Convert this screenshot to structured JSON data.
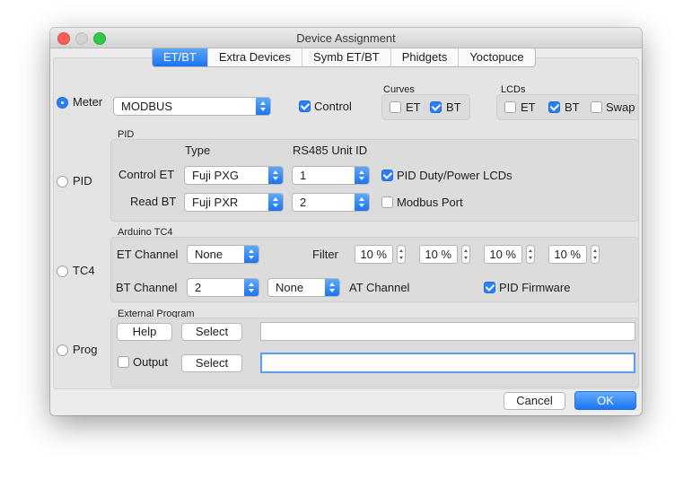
{
  "window": {
    "title": "Device Assignment"
  },
  "tabs": [
    {
      "label": "ET/BT",
      "active": true
    },
    {
      "label": "Extra Devices"
    },
    {
      "label": "Symb ET/BT"
    },
    {
      "label": "Phidgets"
    },
    {
      "label": "Yoctopuce"
    }
  ],
  "modes": [
    {
      "label": "Meter",
      "selected": true
    },
    {
      "label": "PID",
      "selected": false
    },
    {
      "label": "TC4",
      "selected": false
    },
    {
      "label": "Prog",
      "selected": false
    }
  ],
  "meter": {
    "device": "MODBUS",
    "control_label": "Control",
    "control_checked": true
  },
  "curves": {
    "title": "Curves",
    "et_label": "ET",
    "et_checked": false,
    "bt_label": "BT",
    "bt_checked": true
  },
  "lcds": {
    "title": "LCDs",
    "et_label": "ET",
    "et_checked": false,
    "bt_label": "BT",
    "bt_checked": true,
    "swap_label": "Swap",
    "swap_checked": false
  },
  "pid": {
    "title": "PID",
    "type_header": "Type",
    "unit_header": "RS485 Unit ID",
    "control_et_label": "Control ET",
    "control_et_type": "Fuji PXG",
    "control_et_unit": "1",
    "read_bt_label": "Read BT",
    "read_bt_type": "Fuji PXR",
    "read_bt_unit": "2",
    "duty_label": "PID Duty/Power LCDs",
    "duty_checked": true,
    "modbus_label": "Modbus Port",
    "modbus_checked": false
  },
  "arduino": {
    "title": "Arduino TC4",
    "et_channel_label": "ET Channel",
    "et_channel": "None",
    "filter_label": "Filter",
    "filters": [
      "10 %",
      "10 %",
      "10 %",
      "10 %"
    ],
    "bt_channel_label": "BT Channel",
    "bt_channel": "2",
    "at_channel": "None",
    "at_channel_label": "AT Channel",
    "pid_firmware_label": "PID Firmware",
    "pid_firmware_checked": true
  },
  "external": {
    "title": "External Program",
    "help_label": "Help",
    "select_label": "Select",
    "output_label": "Output",
    "output_checked": false,
    "select2_label": "Select",
    "program_path": "",
    "output_path": ""
  },
  "footer": {
    "cancel_label": "Cancel",
    "ok_label": "OK"
  },
  "colors": {
    "accent": "#1b74f2",
    "window_bg": "#ececec"
  }
}
